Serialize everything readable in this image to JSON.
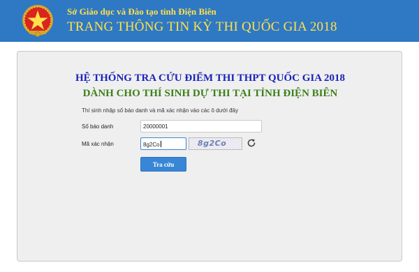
{
  "header": {
    "org_name": "Sở Giáo dục và Đào tạo tỉnh Điện Biên",
    "site_title": "TRANG THÔNG TIN KỲ THI QUỐC GIA 2018",
    "logo_icon": "national-emblem-icon",
    "background_color": "#2f78c4",
    "text_color": "#ffe14a"
  },
  "main": {
    "heading": "HỆ THỐNG TRA CỨU ĐIỂM THI THPT QUỐC GIA 2018",
    "subheading": "DÀNH CHO THÍ SINH DỰ THI TẠI TỈNH ĐIỆN BIÊN",
    "instruction": "Thí sinh nhập số báo danh và mã xác nhận vào các ô dưới đây",
    "heading_color": "#1a23b8",
    "subheading_color": "#3d7f1b"
  },
  "form": {
    "sbd_label": "Số báo danh",
    "sbd_value": "20000001",
    "captcha_label": "Mã xác nhận",
    "captcha_value": "8g2Co",
    "captcha_image_text": "8g2Co",
    "refresh_icon": "refresh-icon",
    "submit_label": "Tra cứu",
    "button_color": "#3886d6"
  }
}
